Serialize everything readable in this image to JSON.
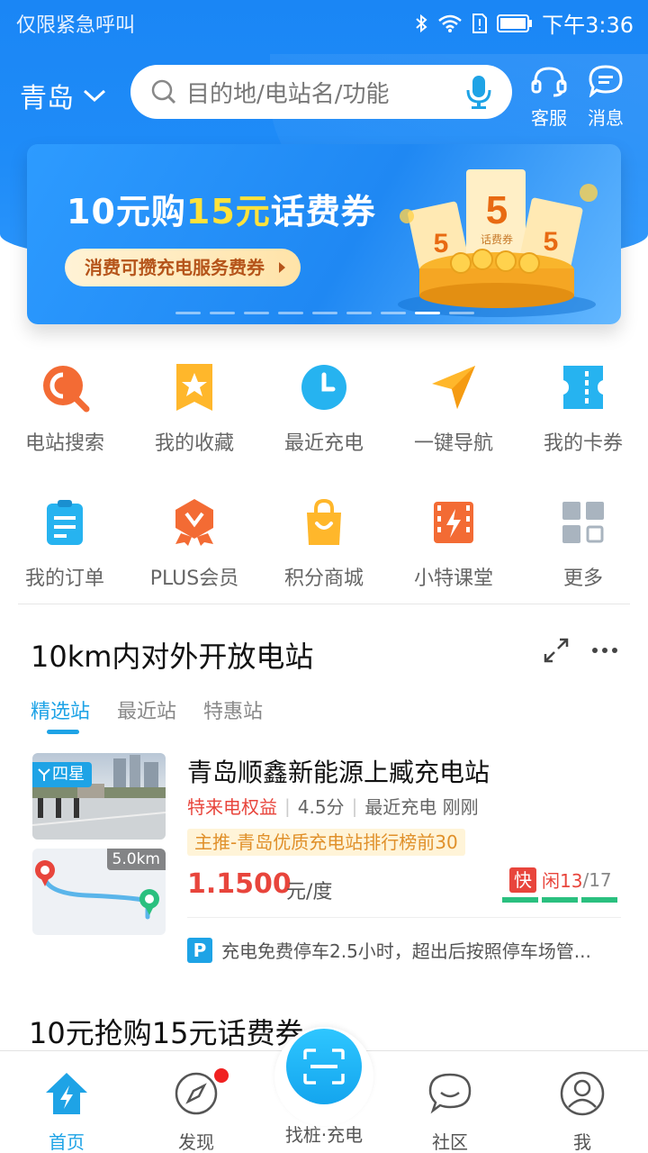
{
  "status_bar": {
    "carrier": "仅限紧急呼叫",
    "time": "下午3:36"
  },
  "header": {
    "city": "青岛",
    "search_placeholder": "目的地/电站名/功能",
    "service_label": "客服",
    "message_label": "消息"
  },
  "banner": {
    "title_prefix": "10元购",
    "title_highlight": "15元",
    "title_suffix": "话费券",
    "pill_text": "消费可攒充电服务费券",
    "coupon_value": "5",
    "coupon_text": "话费券",
    "dot_count": 9,
    "active_dot": 7
  },
  "grid": {
    "row1": [
      {
        "label": "电站搜索",
        "icon": "search-icon"
      },
      {
        "label": "我的收藏",
        "icon": "star-icon"
      },
      {
        "label": "最近充电",
        "icon": "clock-icon"
      },
      {
        "label": "一键导航",
        "icon": "navigation-icon"
      },
      {
        "label": "我的卡券",
        "icon": "ticket-icon"
      }
    ],
    "row2": [
      {
        "label": "我的订单",
        "icon": "clipboard-icon"
      },
      {
        "label": "PLUS会员",
        "icon": "vip-badge-icon"
      },
      {
        "label": "积分商城",
        "icon": "shopping-bag-icon"
      },
      {
        "label": "小特课堂",
        "icon": "video-icon"
      },
      {
        "label": "更多",
        "icon": "apps-grid-icon"
      }
    ]
  },
  "section": {
    "title": "10km内对外开放电站",
    "tabs": [
      "精选站",
      "最近站",
      "特惠站"
    ],
    "active_tab": 0
  },
  "station": {
    "badge": "四星",
    "distance": "5.0km",
    "name": "青岛顺鑫新能源上臧充电站",
    "benefit": "特来电权益",
    "rating": "4.5分",
    "recent": "最近充电 刚刚",
    "tag": "主推-青岛优质充电站排行榜前30",
    "price": "1.1500",
    "unit": "元/度",
    "fast_label": "快",
    "idle_label": "闲13",
    "total": "/17",
    "parking": "充电免费停车2.5小时，超出后按照停车场管..."
  },
  "promo_title": "10元抢购15元话费券",
  "bottom_nav": {
    "home": "首页",
    "discover": "发现",
    "scan_charge": "找桩·充电",
    "community": "社区",
    "me": "我"
  },
  "colors": {
    "primary_blue": "#1a86f5",
    "accent_cyan": "#1ea3e6",
    "price_red": "#e8453c",
    "idle_green": "#2ac07f"
  }
}
